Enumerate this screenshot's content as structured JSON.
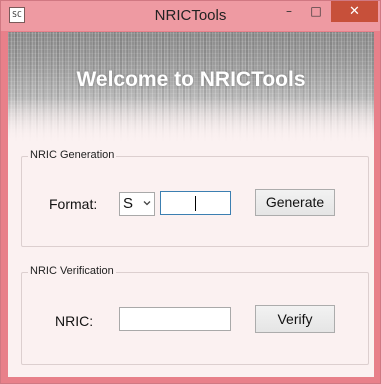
{
  "window": {
    "title": "NRICTools",
    "icon_text": "SC",
    "controls": {
      "minimize": "–",
      "maximize": "□",
      "close": "✕"
    },
    "colors": {
      "frame": "#e8808a",
      "close_button": "#c7503a"
    }
  },
  "banner": {
    "title": "Welcome to NRICTools"
  },
  "generation": {
    "legend": "NRIC Generation",
    "format_label": "Format:",
    "format_selected": "S",
    "input_value": "",
    "button_label": "Generate"
  },
  "verification": {
    "legend": "NRIC Verification",
    "nric_label": "NRIC:",
    "input_value": "",
    "button_label": "Verify"
  }
}
